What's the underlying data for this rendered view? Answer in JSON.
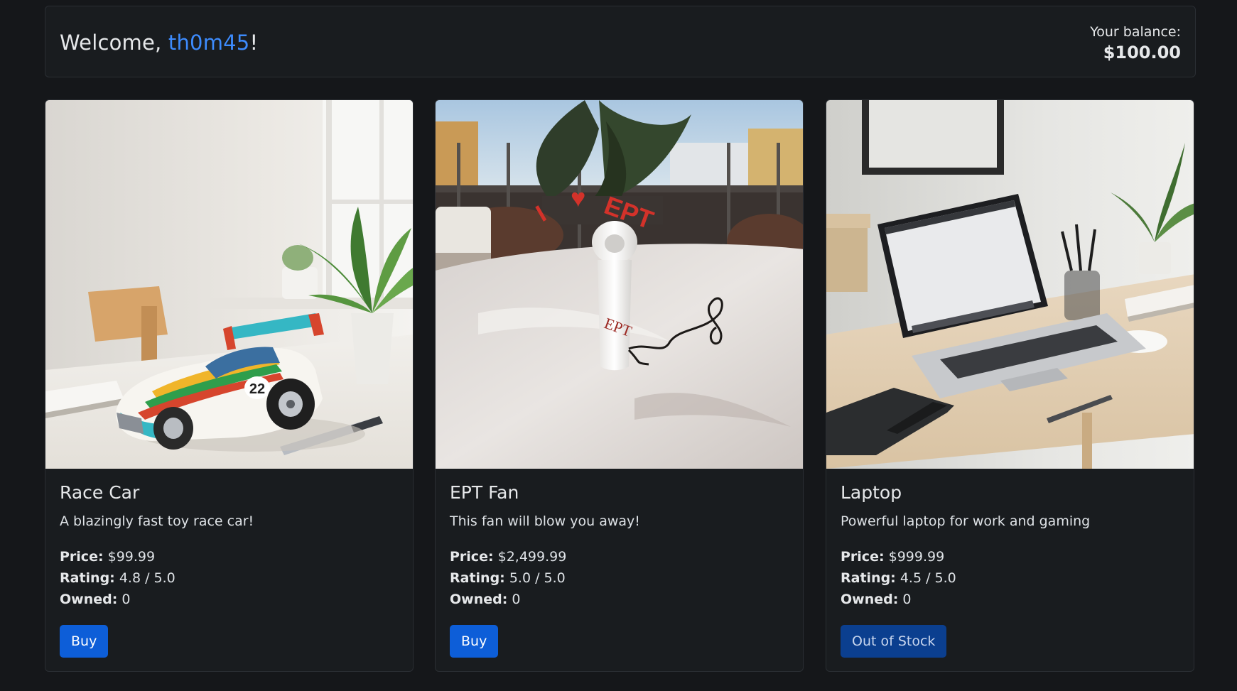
{
  "header": {
    "welcome_prefix": "Welcome, ",
    "username": "th0m45",
    "welcome_suffix": "!",
    "balance_label": "Your balance:",
    "balance_value": "$100.00"
  },
  "labels": {
    "price": "Price:",
    "rating": "Rating:",
    "owned": "Owned:"
  },
  "products": [
    {
      "name": "Race Car",
      "description": "A blazingly fast toy race car!",
      "price": "$99.99",
      "rating": "4.8 / 5.0",
      "owned": "0",
      "button": "Buy",
      "image": "race-car-image",
      "car_number": "22"
    },
    {
      "name": "EPT Fan",
      "description": "This fan will blow you away!",
      "price": "$2,499.99",
      "rating": "5.0 / 5.0",
      "owned": "0",
      "button": "Buy",
      "image": "ept-fan-image",
      "fan_text": "EPT",
      "fan_heart": "I ♥ EPT"
    },
    {
      "name": "Laptop",
      "description": "Powerful laptop for work and gaming",
      "price": "$999.99",
      "rating": "4.5 / 5.0",
      "owned": "0",
      "button": "Out of Stock",
      "image": "laptop-image"
    }
  ],
  "colors": {
    "background": "#15171a",
    "card": "#191c1f",
    "accent": "#3d8bfd",
    "button": "#0d5ed8"
  }
}
